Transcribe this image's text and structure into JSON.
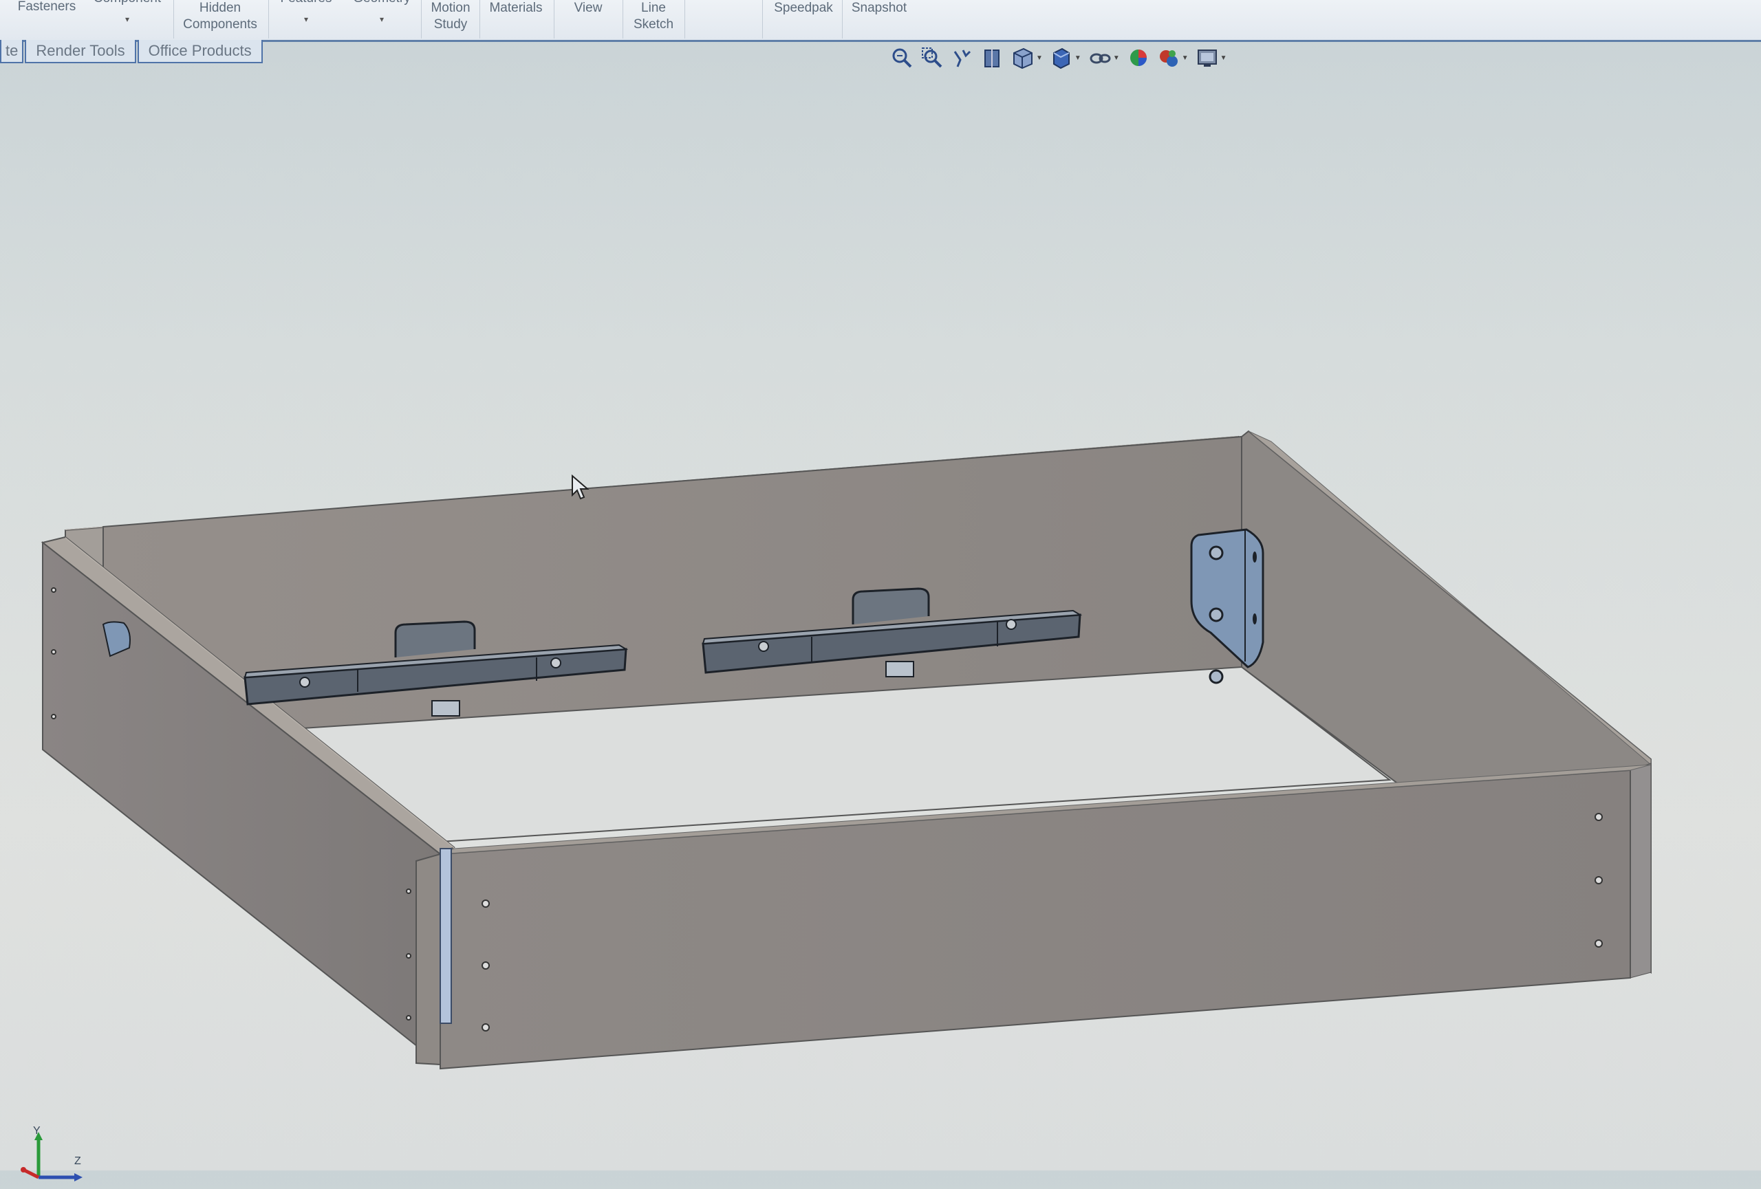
{
  "ribbon": {
    "items": [
      {
        "line1": "Fasteners",
        "line2": ""
      },
      {
        "line1": "Component",
        "line2": ""
      },
      {
        "line1": "Hidden",
        "line2": "Components"
      },
      {
        "line1": "Features",
        "line2": ""
      },
      {
        "line1": "Geometry",
        "line2": ""
      },
      {
        "line1": "Motion",
        "line2": "Study"
      },
      {
        "line1": "Materials",
        "line2": ""
      },
      {
        "line1": "View",
        "line2": ""
      },
      {
        "line1": "Line",
        "line2": "Sketch"
      },
      {
        "line1": "Speedpak",
        "line2": ""
      },
      {
        "line1": "Snapshot",
        "line2": ""
      }
    ]
  },
  "tabs": {
    "items": [
      "te",
      "Render Tools",
      "Office Products"
    ]
  },
  "hud_toolbar": {
    "icons": [
      "zoom-to-fit-icon",
      "zoom-to-area-icon",
      "previous-view-icon",
      "section-view-icon",
      "view-orientation-icon",
      "display-style-icon",
      "hide-show-items-icon",
      "edit-appearance-icon",
      "apply-scene-icon",
      "view-settings-icon"
    ]
  },
  "triad": {
    "y": "Y",
    "z": "Z"
  },
  "colors": {
    "ribbon_border": "#5f7ea8",
    "panel_wood": "#8b8684",
    "panel_top": "#a6a19c",
    "bracket_blue": "#7f97b5",
    "slide_dark": "#5b6470",
    "background": "#d8dcdc"
  }
}
